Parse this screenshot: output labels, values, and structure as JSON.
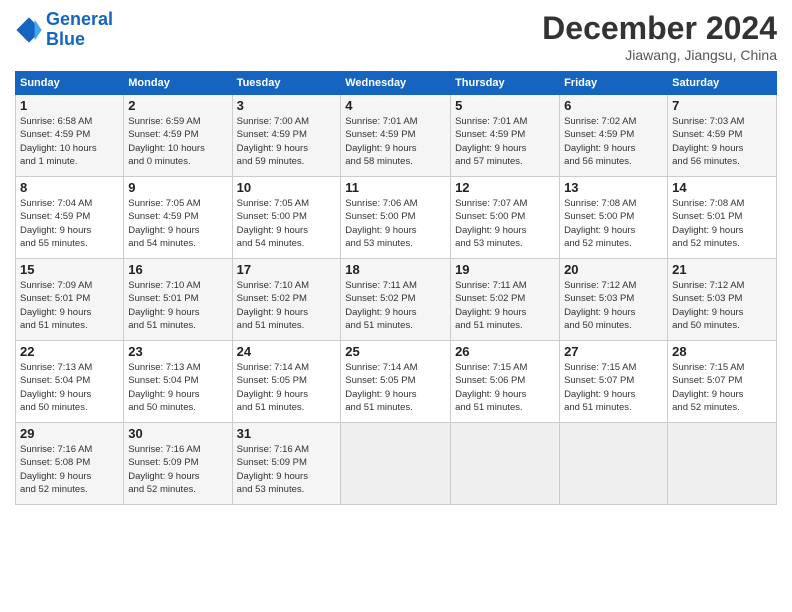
{
  "header": {
    "logo_line1": "General",
    "logo_line2": "Blue",
    "month": "December 2024",
    "location": "Jiawang, Jiangsu, China"
  },
  "weekdays": [
    "Sunday",
    "Monday",
    "Tuesday",
    "Wednesday",
    "Thursday",
    "Friday",
    "Saturday"
  ],
  "weeks": [
    [
      {
        "day": "1",
        "info": "Sunrise: 6:58 AM\nSunset: 4:59 PM\nDaylight: 10 hours\nand 1 minute."
      },
      {
        "day": "2",
        "info": "Sunrise: 6:59 AM\nSunset: 4:59 PM\nDaylight: 10 hours\nand 0 minutes."
      },
      {
        "day": "3",
        "info": "Sunrise: 7:00 AM\nSunset: 4:59 PM\nDaylight: 9 hours\nand 59 minutes."
      },
      {
        "day": "4",
        "info": "Sunrise: 7:01 AM\nSunset: 4:59 PM\nDaylight: 9 hours\nand 58 minutes."
      },
      {
        "day": "5",
        "info": "Sunrise: 7:01 AM\nSunset: 4:59 PM\nDaylight: 9 hours\nand 57 minutes."
      },
      {
        "day": "6",
        "info": "Sunrise: 7:02 AM\nSunset: 4:59 PM\nDaylight: 9 hours\nand 56 minutes."
      },
      {
        "day": "7",
        "info": "Sunrise: 7:03 AM\nSunset: 4:59 PM\nDaylight: 9 hours\nand 56 minutes."
      }
    ],
    [
      {
        "day": "8",
        "info": "Sunrise: 7:04 AM\nSunset: 4:59 PM\nDaylight: 9 hours\nand 55 minutes."
      },
      {
        "day": "9",
        "info": "Sunrise: 7:05 AM\nSunset: 4:59 PM\nDaylight: 9 hours\nand 54 minutes."
      },
      {
        "day": "10",
        "info": "Sunrise: 7:05 AM\nSunset: 5:00 PM\nDaylight: 9 hours\nand 54 minutes."
      },
      {
        "day": "11",
        "info": "Sunrise: 7:06 AM\nSunset: 5:00 PM\nDaylight: 9 hours\nand 53 minutes."
      },
      {
        "day": "12",
        "info": "Sunrise: 7:07 AM\nSunset: 5:00 PM\nDaylight: 9 hours\nand 53 minutes."
      },
      {
        "day": "13",
        "info": "Sunrise: 7:08 AM\nSunset: 5:00 PM\nDaylight: 9 hours\nand 52 minutes."
      },
      {
        "day": "14",
        "info": "Sunrise: 7:08 AM\nSunset: 5:01 PM\nDaylight: 9 hours\nand 52 minutes."
      }
    ],
    [
      {
        "day": "15",
        "info": "Sunrise: 7:09 AM\nSunset: 5:01 PM\nDaylight: 9 hours\nand 51 minutes."
      },
      {
        "day": "16",
        "info": "Sunrise: 7:10 AM\nSunset: 5:01 PM\nDaylight: 9 hours\nand 51 minutes."
      },
      {
        "day": "17",
        "info": "Sunrise: 7:10 AM\nSunset: 5:02 PM\nDaylight: 9 hours\nand 51 minutes."
      },
      {
        "day": "18",
        "info": "Sunrise: 7:11 AM\nSunset: 5:02 PM\nDaylight: 9 hours\nand 51 minutes."
      },
      {
        "day": "19",
        "info": "Sunrise: 7:11 AM\nSunset: 5:02 PM\nDaylight: 9 hours\nand 51 minutes."
      },
      {
        "day": "20",
        "info": "Sunrise: 7:12 AM\nSunset: 5:03 PM\nDaylight: 9 hours\nand 50 minutes."
      },
      {
        "day": "21",
        "info": "Sunrise: 7:12 AM\nSunset: 5:03 PM\nDaylight: 9 hours\nand 50 minutes."
      }
    ],
    [
      {
        "day": "22",
        "info": "Sunrise: 7:13 AM\nSunset: 5:04 PM\nDaylight: 9 hours\nand 50 minutes."
      },
      {
        "day": "23",
        "info": "Sunrise: 7:13 AM\nSunset: 5:04 PM\nDaylight: 9 hours\nand 50 minutes."
      },
      {
        "day": "24",
        "info": "Sunrise: 7:14 AM\nSunset: 5:05 PM\nDaylight: 9 hours\nand 51 minutes."
      },
      {
        "day": "25",
        "info": "Sunrise: 7:14 AM\nSunset: 5:05 PM\nDaylight: 9 hours\nand 51 minutes."
      },
      {
        "day": "26",
        "info": "Sunrise: 7:15 AM\nSunset: 5:06 PM\nDaylight: 9 hours\nand 51 minutes."
      },
      {
        "day": "27",
        "info": "Sunrise: 7:15 AM\nSunset: 5:07 PM\nDaylight: 9 hours\nand 51 minutes."
      },
      {
        "day": "28",
        "info": "Sunrise: 7:15 AM\nSunset: 5:07 PM\nDaylight: 9 hours\nand 52 minutes."
      }
    ],
    [
      {
        "day": "29",
        "info": "Sunrise: 7:16 AM\nSunset: 5:08 PM\nDaylight: 9 hours\nand 52 minutes."
      },
      {
        "day": "30",
        "info": "Sunrise: 7:16 AM\nSunset: 5:09 PM\nDaylight: 9 hours\nand 52 minutes."
      },
      {
        "day": "31",
        "info": "Sunrise: 7:16 AM\nSunset: 5:09 PM\nDaylight: 9 hours\nand 53 minutes."
      },
      null,
      null,
      null,
      null
    ]
  ]
}
